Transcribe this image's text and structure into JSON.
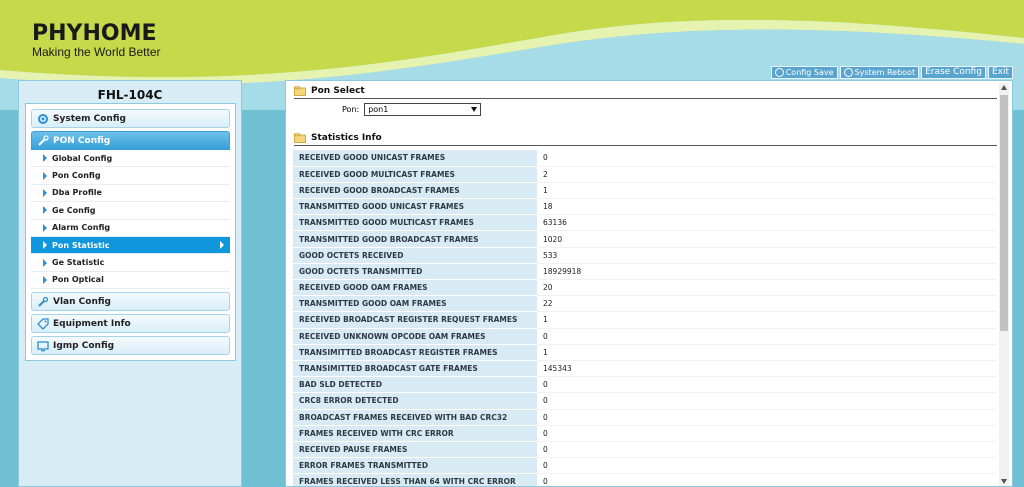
{
  "brand": {
    "name": "PHYHOME",
    "tagline": "Making the World Better"
  },
  "top_buttons": {
    "config_save": "Config Save",
    "system_reboot": "System Reboot",
    "erase_config": "Erase Config",
    "exit": "Exit"
  },
  "sidebar": {
    "device": "FHL-104C",
    "groups": [
      {
        "label": "System Config",
        "icon": "gear-icon"
      },
      {
        "label": "PON Config",
        "icon": "tools-icon"
      },
      {
        "label": "Vlan Config",
        "icon": "wrench-icon"
      },
      {
        "label": "Equipment Info",
        "icon": "tag-icon"
      },
      {
        "label": "Igmp Config",
        "icon": "monitor-icon"
      }
    ],
    "pon_items": [
      "Global Config",
      "Pon Config",
      "Dba Profile",
      "Ge Config",
      "Alarm Config",
      "Pon Statistic",
      "Ge Statistic",
      "Pon Optical"
    ],
    "active_item": "Pon Statistic"
  },
  "pon_select": {
    "title": "Pon Select",
    "label": "Pon:",
    "value": "pon1"
  },
  "stats": {
    "title": "Statistics Info",
    "rows": [
      {
        "label": "RECEIVED GOOD UNICAST FRAMES",
        "value": "0"
      },
      {
        "label": "RECEIVED GOOD MULTICAST FRAMES",
        "value": "2"
      },
      {
        "label": "RECEIVED GOOD BROADCAST FRAMES",
        "value": "1"
      },
      {
        "label": "TRANSMITTED GOOD UNICAST FRAMES",
        "value": "18"
      },
      {
        "label": "TRANSMITTED GOOD MULTICAST FRAMES",
        "value": "63136"
      },
      {
        "label": "TRANSMITTED GOOD BROADCAST FRAMES",
        "value": "1020"
      },
      {
        "label": "GOOD OCTETS RECEIVED",
        "value": "533"
      },
      {
        "label": "GOOD OCTETS TRANSMITTED",
        "value": "18929918"
      },
      {
        "label": "RECEIVED GOOD OAM FRAMES",
        "value": "20"
      },
      {
        "label": "TRANSMITTED GOOD OAM FRAMES",
        "value": "22"
      },
      {
        "label": "RECEIVED BROADCAST REGISTER REQUEST FRAMES",
        "value": "1"
      },
      {
        "label": "RECEIVED UNKNOWN OPCODE OAM FRAMES",
        "value": "0"
      },
      {
        "label": "TRANSIMITTED BROADCAST REGISTER FRAMES",
        "value": "1"
      },
      {
        "label": "TRANSIMITTED BROADCAST GATE FRAMES",
        "value": "145343"
      },
      {
        "label": "BAD SLD DETECTED",
        "value": "0"
      },
      {
        "label": "CRC8 ERROR DETECTED",
        "value": "0"
      },
      {
        "label": "BROADCAST FRAMES RECEIVED WITH BAD CRC32",
        "value": "0"
      },
      {
        "label": "FRAMES RECEIVED WITH CRC ERROR",
        "value": "0"
      },
      {
        "label": "RECEIVED PAUSE FRAMES",
        "value": "0"
      },
      {
        "label": "ERROR FRAMES TRANSMITTED",
        "value": "0"
      },
      {
        "label": "FRAMES RECEIVED LESS THAN 64 WITH CRC ERROR",
        "value": "0"
      }
    ]
  },
  "colors": {
    "header_green": "#c5d94a",
    "background_blue": "#6fc0d3",
    "active_blue": "#0f96dc"
  }
}
